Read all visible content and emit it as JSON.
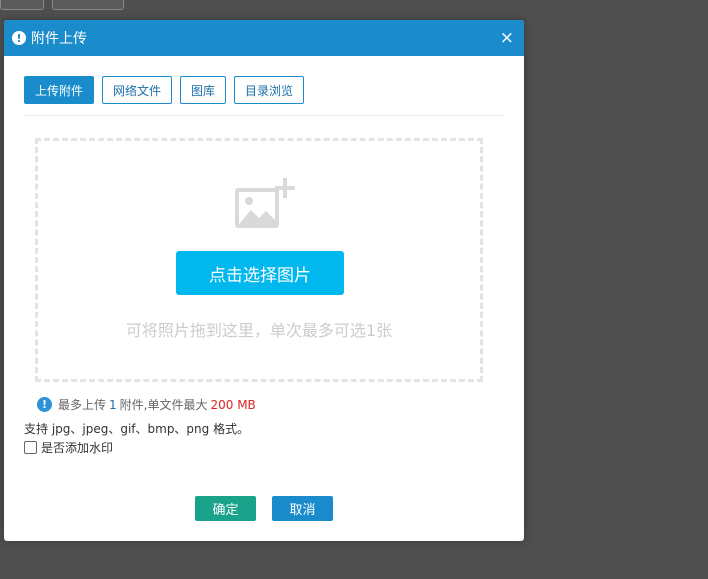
{
  "dialog": {
    "title": "附件上传",
    "close_symbol": "×"
  },
  "tabs": [
    {
      "label": "上传附件",
      "active": true
    },
    {
      "label": "网络文件",
      "active": false
    },
    {
      "label": "图库",
      "active": false
    },
    {
      "label": "目录浏览",
      "active": false
    }
  ],
  "dropzone": {
    "icon": "add-image-icon",
    "button_label": "点击选择图片",
    "hint": "可将照片拖到这里，单次最多可选1张"
  },
  "info": {
    "prefix": "最多上传",
    "max_count": "1",
    "middle": "附件,单文件最大",
    "max_size": "200 MB"
  },
  "formats_text": "支持 jpg、jpeg、gif、bmp、png 格式。",
  "watermark_label": "是否添加水印",
  "watermark_checked": false,
  "buttons": {
    "ok": "确定",
    "cancel": "取消"
  },
  "colors": {
    "header": "#1a8ccb",
    "select_button": "#00b7ee",
    "ok_button": "#1aa28b",
    "cancel_button": "#1a8ccb",
    "size_highlight": "#dd2222"
  }
}
